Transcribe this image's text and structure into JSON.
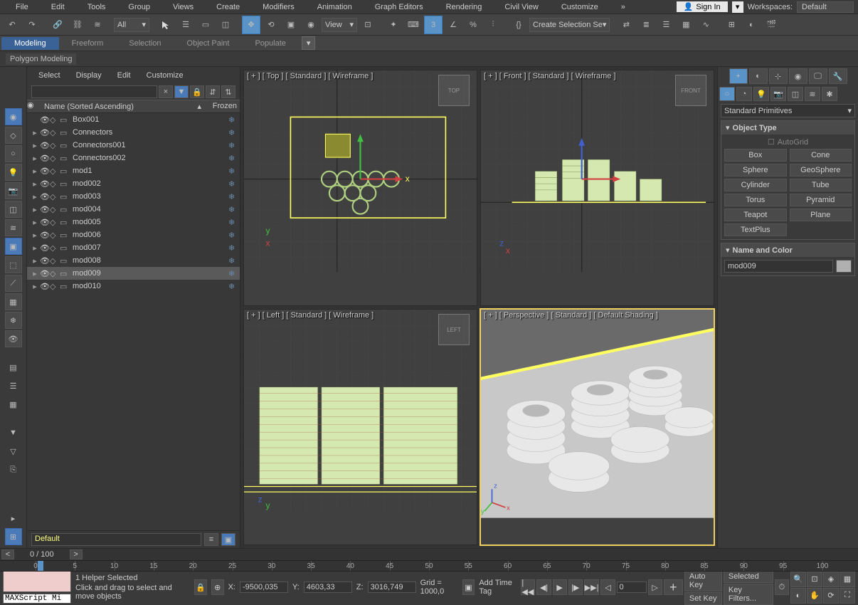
{
  "menubar": {
    "items": [
      "File",
      "Edit",
      "Tools",
      "Group",
      "Views",
      "Create",
      "Modifiers",
      "Animation",
      "Graph Editors",
      "Rendering",
      "Civil View",
      "Customize"
    ],
    "sign_in": "Sign In",
    "workspaces_label": "Workspaces:",
    "workspace": "Default"
  },
  "toolbar": {
    "all_filter": "All",
    "view_ref": "View",
    "selection_set": "Create Selection Se"
  },
  "ribbon": {
    "tabs": [
      "Modeling",
      "Freeform",
      "Selection",
      "Object Paint",
      "Populate"
    ],
    "active": 0,
    "sub": "Polygon Modeling"
  },
  "scene": {
    "menu": [
      "Select",
      "Display",
      "Edit",
      "Customize"
    ],
    "search_placeholder": "",
    "col_name": "Name (Sorted Ascending)",
    "col_frozen": "Frozen",
    "items": [
      {
        "name": "Box001",
        "expandable": false
      },
      {
        "name": "Connectors",
        "expandable": true
      },
      {
        "name": "Connectors001",
        "expandable": true
      },
      {
        "name": "Connectors002",
        "expandable": true
      },
      {
        "name": "mod1",
        "expandable": true
      },
      {
        "name": "mod002",
        "expandable": true
      },
      {
        "name": "mod003",
        "expandable": true
      },
      {
        "name": "mod004",
        "expandable": true
      },
      {
        "name": "mod005",
        "expandable": true
      },
      {
        "name": "mod006",
        "expandable": true
      },
      {
        "name": "mod007",
        "expandable": true
      },
      {
        "name": "mod008",
        "expandable": true
      },
      {
        "name": "mod009",
        "expandable": true,
        "selected": true
      },
      {
        "name": "mod010",
        "expandable": true
      }
    ],
    "layer_dd": "Default"
  },
  "viewports": {
    "v0": "[ + ] [ Top ] [ Standard ] [ Wireframe ]",
    "v1": "[ + ] [ Front ] [ Standard ] [ Wireframe ]",
    "v2": "[ + ] [ Left ] [ Standard ] [ Wireframe ]",
    "v3": "[ + ] [ Perspective ] [ Standard ] [ Default Shading ]",
    "cube0": "TOP",
    "cube1": "FRONT",
    "cube2": "LEFT",
    "axis_top_x": "x",
    "axis_top_y": "y",
    "axis_z": "z"
  },
  "command": {
    "category": "Standard Primitives",
    "object_type_title": "Object Type",
    "autogrid": "AutoGrid",
    "buttons": [
      [
        "Box",
        "Cone"
      ],
      [
        "Sphere",
        "GeoSphere"
      ],
      [
        "Cylinder",
        "Tube"
      ],
      [
        "Torus",
        "Pyramid"
      ],
      [
        "Teapot",
        "Plane"
      ],
      [
        "TextPlus",
        ""
      ]
    ],
    "name_color_title": "Name and Color",
    "obj_name": "mod009"
  },
  "timeline": {
    "pos": "0 / 100",
    "ticks": [
      0,
      5,
      10,
      15,
      20,
      25,
      30,
      35,
      40,
      45,
      50,
      55,
      60,
      65,
      70,
      75,
      80,
      85,
      90,
      95,
      100
    ]
  },
  "status": {
    "sel": "1 Helper Selected",
    "hint": "Click and drag to select and move objects",
    "x_label": "X:",
    "y_label": "Y:",
    "z_label": "Z:",
    "x": "-9500,035",
    "y": "4603,33",
    "z": "3016,749",
    "grid": "Grid = 1000,0",
    "add_tag": "Add Time Tag",
    "frame": "0",
    "auto_key": "Auto Key",
    "set_key": "Set Key",
    "filter_dd": "Selected",
    "key_filters": "Key Filters...",
    "maxscript": "MAXScript Mi"
  }
}
